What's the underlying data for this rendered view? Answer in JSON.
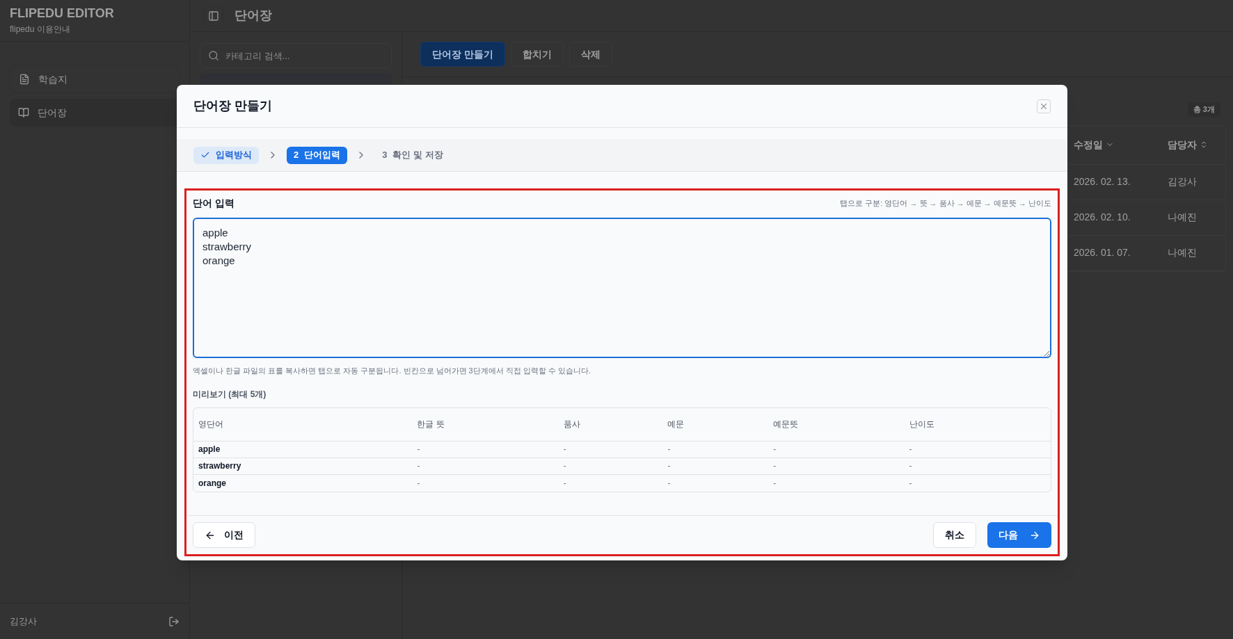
{
  "app": {
    "title": "FLIPEDU EDITOR",
    "subtitle": "flipedu 이용안내"
  },
  "sidebar": {
    "items": [
      {
        "label": "학습지",
        "selected": false
      },
      {
        "label": "단어장",
        "selected": true
      }
    ],
    "user": "김강사"
  },
  "page_title": "단어장",
  "category_search": {
    "placeholder": "카테고리 검색..."
  },
  "toolbar": [
    {
      "label": "단어장 만들기",
      "kind": "primary"
    },
    {
      "label": "합치기",
      "kind": "default"
    },
    {
      "label": "삭제",
      "kind": "default"
    }
  ],
  "list": {
    "count": "총 3개",
    "columns": [
      "수정일",
      "담당자"
    ],
    "rows": [
      [
        "2026. 02. 13.",
        "김강사"
      ],
      [
        "2026. 02. 10.",
        "나예진"
      ],
      [
        "2026. 01. 07.",
        "나예진"
      ]
    ]
  },
  "modal": {
    "title": "단어장 만들기",
    "steps": [
      {
        "label": "입력방식",
        "done": true,
        "selected": false
      },
      {
        "number": "2",
        "label": "단어입력",
        "done": false,
        "selected": true
      },
      {
        "number": "3",
        "label": "확인 및 저장",
        "done": false,
        "selected": false
      }
    ],
    "input": {
      "label": "단어 입력",
      "hint": "탭으로 구분: 영단어 → 뜻 → 품사 → 예문 → 예문뜻 → 난이도",
      "value": "apple\nstrawberry\norange"
    },
    "help": "엑셀이나 한글 파일의 표를 복사하면 탭으로 자동 구분됩니다. 빈칸으로 넘어가면 3단계에서 직접 입력할 수 있습니다.",
    "preview": {
      "title": "미리보기 (최대 5개)",
      "columns": [
        "영단어",
        "한글 뜻",
        "품사",
        "예문",
        "예문뜻",
        "난이도"
      ],
      "rows": [
        [
          "apple",
          "-",
          "-",
          "-",
          "-",
          "-"
        ],
        [
          "strawberry",
          "-",
          "-",
          "-",
          "-",
          "-"
        ],
        [
          "orange",
          "-",
          "-",
          "-",
          "-",
          "-"
        ]
      ]
    },
    "footer": {
      "prev": "이전",
      "cancel": "취소",
      "next": "다음"
    }
  }
}
